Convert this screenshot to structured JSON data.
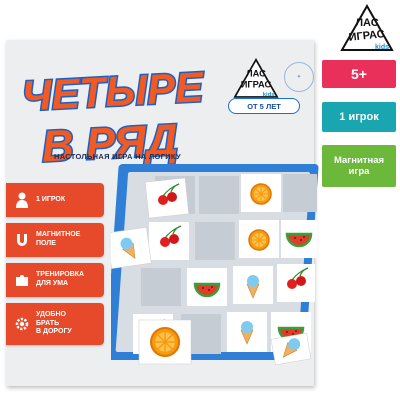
{
  "brand": {
    "line1": "ЛАС",
    "line2": "ИГРАС",
    "sub": "kids"
  },
  "box": {
    "title_line1": "ЧЕТЫРЕ",
    "title_line2": "В РЯД",
    "subtitle": "НАСТОЛЬНАЯ ИГРА НА ЛОГИКУ",
    "age": "ОТ 5 ЛЕТ",
    "features": [
      {
        "icon": "person-icon",
        "label": "1 ИГРОК"
      },
      {
        "icon": "magnet-icon",
        "label": "МАГНИТНОЕ\nПОЛЕ"
      },
      {
        "icon": "puzzle-icon",
        "label": "ТРЕНИРОВКА\nДЛЯ УМА"
      },
      {
        "icon": "gear-icon",
        "label": "УДОБНО\nБРАТЬ\nВ ДОРОГУ"
      }
    ]
  },
  "badges": [
    {
      "label": "5+",
      "color": "#e8305a"
    },
    {
      "label": "1 игрок",
      "color": "#1aa6b0"
    },
    {
      "label": "Магнитная\nигра",
      "color": "#6cb83a"
    }
  ],
  "colors": {
    "title_fill": "#f15a22",
    "title_outline": "#1f5fc4",
    "board_frame": "#2f7fd6"
  }
}
